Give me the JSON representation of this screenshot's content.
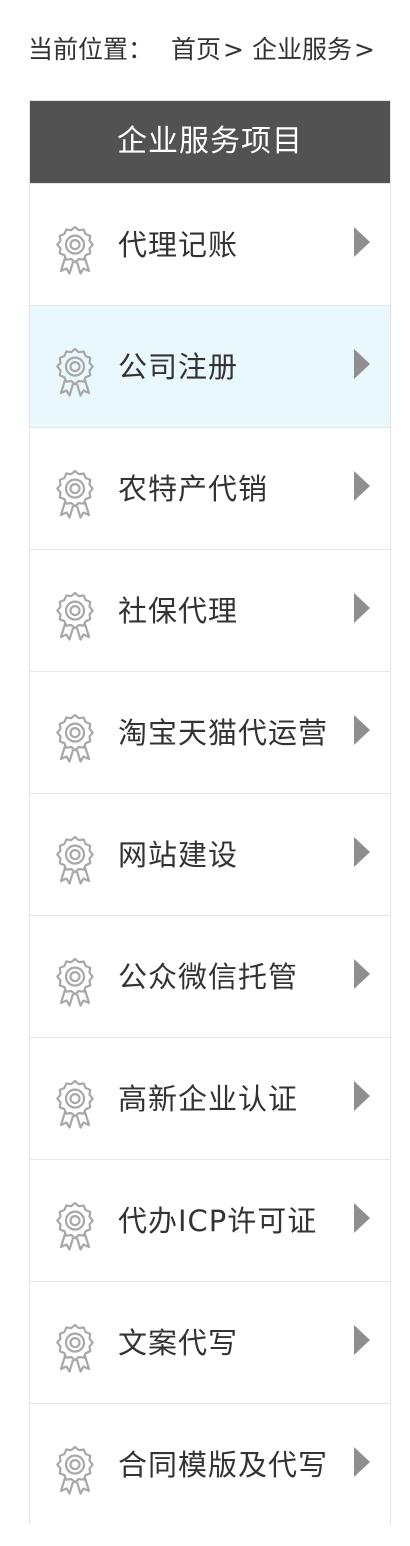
{
  "breadcrumb": {
    "label": "当前位置：",
    "items": [
      "首页",
      "企业服务"
    ],
    "separator": ">"
  },
  "sidebar": {
    "title": "企业服务项目",
    "item_icon": "award-badge-icon",
    "arrow_icon": "caret-right-icon",
    "active_color": "#e8f8fc",
    "header_color": "#525252",
    "items": [
      {
        "label": "代理记账",
        "active": false
      },
      {
        "label": "公司注册",
        "active": true
      },
      {
        "label": "农特产代销",
        "active": false
      },
      {
        "label": "社保代理",
        "active": false
      },
      {
        "label": "淘宝天猫代运营",
        "active": false
      },
      {
        "label": "网站建设",
        "active": false
      },
      {
        "label": "公众微信托管",
        "active": false
      },
      {
        "label": "高新企业认证",
        "active": false
      },
      {
        "label": "代办ICP许可证",
        "active": false
      },
      {
        "label": "文案代写",
        "active": false
      },
      {
        "label": "合同模版及代写",
        "active": false
      }
    ]
  }
}
